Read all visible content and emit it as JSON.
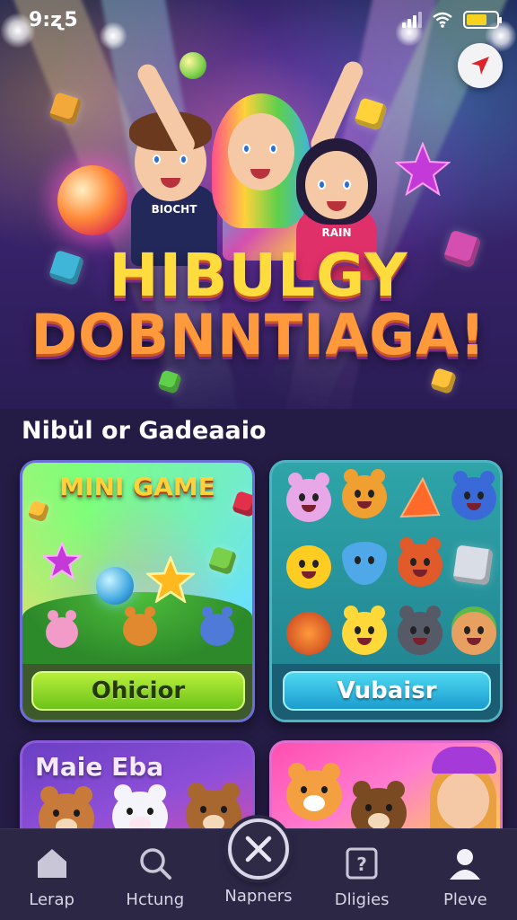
{
  "status_bar": {
    "time": "9:ʐ5",
    "battery_color": "#f7d21e"
  },
  "hero": {
    "title_line_1": "HIBULGY",
    "title_line_2": "DOBNNTIAGA!",
    "shirt_left": "BIOCHT",
    "shirt_right": "RAIN"
  },
  "section": {
    "title": "Nibu̇l or Gadeaaio"
  },
  "cards": {
    "mini_game": {
      "heading": "MINI GAME",
      "button_label": "Ohicior",
      "button_color": "#8fd628"
    },
    "critters": {
      "button_label": "Vubaisr",
      "button_color": "#2fb8e0"
    },
    "bottom_left": {
      "heading": "Maie Eba"
    }
  },
  "tab_bar": {
    "items": [
      {
        "label": "Lerap",
        "icon": "home-icon"
      },
      {
        "label": "Hctung",
        "icon": "search-icon"
      },
      {
        "label": "Napners",
        "icon": "close-x-icon"
      },
      {
        "label": "Dligies",
        "icon": "question-icon"
      },
      {
        "label": "Pleve",
        "icon": "profile-icon"
      }
    ]
  },
  "colors": {
    "background": "#241c44",
    "tab_bar": "#2b2745",
    "title_yellow": "#ffdc3e",
    "title_orange": "#ff9a3c"
  }
}
